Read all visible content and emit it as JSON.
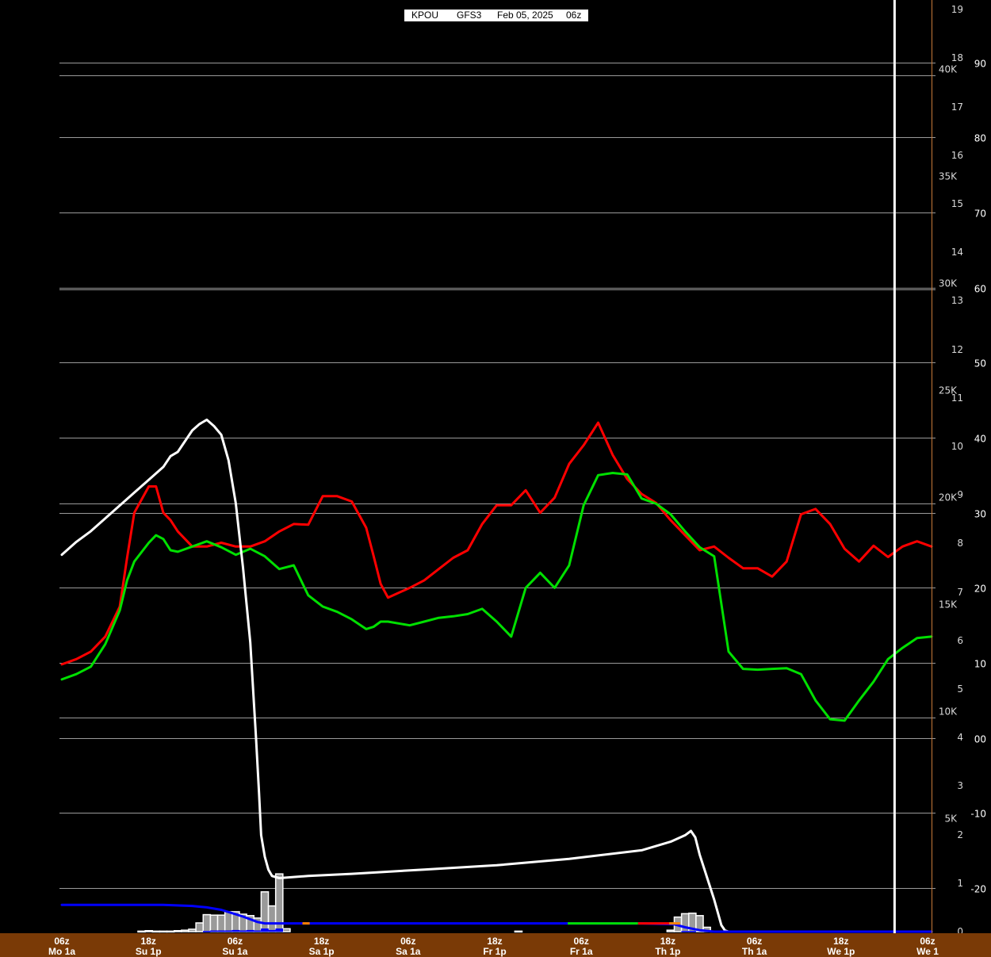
{
  "header": {
    "station": "KPOU",
    "model": "GFS3",
    "date": "Feb 05, 2025",
    "cycle": "06z"
  },
  "colors": {
    "background": "#000000",
    "grid": "#9a9a9a",
    "temperature": "#ff0000",
    "dewpoint": "#00e000",
    "freezing_level": "#ffffff",
    "snow_total": "#0000ff",
    "precip_bars": "#9a9a9a",
    "time_bar": "#7a3a06",
    "right_axis_line": "#c87a3a"
  },
  "chart_data": {
    "type": "line",
    "x_axis": {
      "ticks": [
        {
          "hour": "06z",
          "day": "Mo 1a"
        },
        {
          "hour": "18z",
          "day": "Su 1p"
        },
        {
          "hour": "06z",
          "day": "Su 1a"
        },
        {
          "hour": "18z",
          "day": "Sa 1p"
        },
        {
          "hour": "06z",
          "day": "Sa 1a"
        },
        {
          "hour": "18z",
          "day": "Fr 1p"
        },
        {
          "hour": "06z",
          "day": "Fr 1a"
        },
        {
          "hour": "18z",
          "day": "Th 1p"
        },
        {
          "hour": "06z",
          "day": "Th 1a"
        },
        {
          "hour": "18z",
          "day": "We 1p"
        },
        {
          "hour": "06z",
          "day": "We 1"
        }
      ],
      "range_hours": [
        0,
        120
      ],
      "current_time_hour": 114.9
    },
    "temperature_axis": {
      "ticks": [
        -20,
        -10,
        0,
        10,
        20,
        30,
        40,
        50,
        60,
        70,
        80,
        90
      ],
      "tick_labels": [
        "-20",
        "-10",
        "00",
        "10",
        "20",
        "30",
        "40",
        "50",
        "60",
        "70",
        "80",
        "90"
      ],
      "range": [
        -25.8,
        98.3
      ]
    },
    "height_axis": {
      "ticks": [
        5,
        10,
        15,
        20,
        25,
        30,
        35,
        40
      ],
      "tick_labels": [
        "5K",
        "10K",
        "15K",
        "20K",
        "25K",
        "30K",
        "35K",
        "40K"
      ],
      "unit": "thousand ft",
      "range": [
        0,
        43.5
      ]
    },
    "precip_axis": {
      "ticks": [
        0,
        1,
        2,
        3,
        4,
        5,
        6,
        7,
        8,
        9,
        10,
        11,
        12,
        13,
        14,
        15,
        16,
        17,
        18,
        19
      ],
      "tick_labels": [
        "0",
        "1",
        "2",
        "3",
        "4",
        "5",
        "6",
        "7",
        "8",
        "9",
        "10",
        "11",
        "12",
        "13",
        "14",
        "15",
        "16",
        "17",
        "18",
        "19"
      ],
      "range": [
        0,
        19.2
      ]
    },
    "grid": true,
    "series": [
      {
        "type": "line",
        "axis": "temperature",
        "color": "#ff0000",
        "x": [
          0,
          2,
          4,
          6,
          8,
          9,
          10,
          12,
          13,
          14,
          15,
          16,
          18,
          20,
          22,
          24,
          26,
          28,
          30,
          32,
          34,
          36,
          38,
          40,
          42,
          43,
          44,
          45,
          48,
          50,
          52,
          54,
          56,
          58,
          60,
          62,
          64,
          66,
          68,
          70,
          72,
          74,
          76,
          78,
          80,
          82,
          84,
          86,
          88,
          90,
          92,
          94,
          96,
          98,
          100,
          102,
          104,
          106,
          108,
          110,
          112,
          114,
          116,
          118,
          120
        ],
        "y": [
          9.8,
          10.5,
          11.5,
          13.5,
          17.5,
          24,
          30,
          33.5,
          33.5,
          30,
          29,
          27.5,
          25.5,
          25.5,
          26,
          25.5,
          25.5,
          26.2,
          27.5,
          28.5,
          28.4,
          32.2,
          32.2,
          31.5,
          28,
          24.3,
          20.5,
          18.7,
          20,
          21,
          22.5,
          24,
          25,
          28.5,
          31,
          31,
          33,
          30,
          32,
          36.5,
          39,
          42,
          37.7,
          34.5,
          32.5,
          31.3,
          29,
          27,
          25,
          25.5,
          24,
          22.6,
          22.6,
          21.5,
          23.5,
          29.8,
          30.5,
          28.5,
          25.2,
          23.5,
          25.6,
          24.1,
          25.5,
          26.2,
          25.5
        ]
      },
      {
        "type": "line",
        "axis": "temperature",
        "color": "#00e000",
        "x": [
          0,
          2,
          4,
          6,
          8,
          9,
          10,
          12,
          13,
          14,
          15,
          16,
          18,
          20,
          22,
          24,
          26,
          28,
          30,
          32,
          34,
          36,
          38,
          40,
          42,
          43,
          44,
          45,
          48,
          50,
          52,
          54,
          56,
          58,
          60,
          62,
          64,
          66,
          68,
          70,
          72,
          74,
          76,
          78,
          80,
          82,
          84,
          86,
          88,
          90,
          92,
          94,
          96,
          98,
          100,
          102,
          104,
          106,
          108,
          110,
          112,
          114,
          116,
          118,
          120
        ],
        "y": [
          7.8,
          8.5,
          9.5,
          12.5,
          17,
          21,
          23.5,
          26,
          27,
          26.5,
          25,
          24.8,
          25.5,
          26.2,
          25.4,
          24.4,
          25.2,
          24.2,
          22.5,
          23,
          19,
          17.5,
          16.8,
          15.8,
          14.5,
          14.8,
          15.5,
          15.5,
          15,
          15.5,
          16,
          16.2,
          16.5,
          17.2,
          15.5,
          13.5,
          20,
          22,
          20,
          23,
          31,
          35,
          35.3,
          35.1,
          31.9,
          31.2,
          29.8,
          27.5,
          25.4,
          24.2,
          11.5,
          9.2,
          9.1,
          9.2,
          9.3,
          8.5,
          5,
          2.5,
          2.3,
          5,
          7.5,
          10.5,
          12,
          13.3,
          13.5
        ]
      },
      {
        "type": "line",
        "axis": "height",
        "color": "#ffffff",
        "x": [
          0,
          2,
          4,
          6,
          8,
          10,
          12,
          14,
          15,
          16,
          17,
          18,
          19,
          20,
          21,
          22,
          23,
          24,
          25,
          26,
          26.8,
          27.2,
          27.5,
          28,
          28.5,
          29,
          30,
          34,
          40,
          50,
          60,
          70,
          80,
          84,
          86,
          86.8,
          87.4,
          88,
          90,
          91,
          91.5,
          92,
          93,
          94,
          100,
          110,
          120
        ],
        "y": [
          17.6,
          18.2,
          18.7,
          19.3,
          19.9,
          20.5,
          21.1,
          21.7,
          22.2,
          22.4,
          22.9,
          23.4,
          23.7,
          23.9,
          23.6,
          23.2,
          22,
          20,
          17,
          13.5,
          9,
          6.5,
          4.5,
          3.5,
          2.9,
          2.6,
          2.5,
          2.6,
          2.7,
          2.9,
          3.1,
          3.4,
          3.8,
          4.2,
          4.5,
          4.7,
          4.4,
          3.6,
          1.5,
          0.3,
          0.05,
          0,
          0,
          0,
          0,
          0,
          0
        ]
      },
      {
        "type": "line",
        "axis": "precip",
        "color": "#0000ff",
        "segments": [
          {
            "from_hour": 33.2,
            "to_hour": 34.2,
            "color": "#ff8000"
          },
          {
            "from_hour": 69.8,
            "to_hour": 79.5,
            "color": "#00e000"
          },
          {
            "from_hour": 79.5,
            "to_hour": 83.8,
            "color": "#ff0000"
          },
          {
            "from_hour": 83.8,
            "to_hour": 85.3,
            "color": "#ff8000"
          }
        ],
        "x": [
          0,
          14,
          18,
          20,
          22,
          23.5,
          25,
          27,
          28,
          29,
          29.7,
          30.5,
          40,
          60,
          80,
          84.5,
          86,
          88,
          90,
          91,
          92,
          120
        ],
        "y": [
          0.55,
          0.55,
          0.53,
          0.5,
          0.45,
          0.38,
          0.31,
          0.2,
          0.17,
          0.17,
          0.17,
          0.17,
          0.17,
          0.17,
          0.17,
          0.15,
          0.09,
          0.03,
          0,
          0,
          0,
          0
        ]
      },
      {
        "type": "bar",
        "axis": "precip",
        "color": "#9a9a9a",
        "bar_width_hours": 1,
        "x": [
          11,
          12,
          13,
          14,
          15,
          16,
          17,
          18,
          19,
          20,
          21,
          22,
          23,
          24,
          25,
          26,
          27,
          28,
          29,
          30,
          31,
          63,
          84,
          85,
          86,
          87,
          88,
          89,
          90,
          91
        ],
        "y": [
          0.01,
          0.02,
          0.01,
          0.01,
          0.01,
          0.02,
          0.03,
          0.05,
          0.18,
          0.35,
          0.34,
          0.34,
          0.41,
          0.41,
          0.36,
          0.33,
          0.28,
          0.82,
          0.53,
          1.19,
          0.06,
          0.01,
          0.03,
          0.3,
          0.37,
          0.38,
          0.33,
          0.09,
          0.01,
          0.01
        ]
      },
      {
        "type": "bar",
        "axis": "precip",
        "color": "#0000ff",
        "bar_width_hours": 1,
        "x": [
          20,
          21,
          22,
          23,
          24,
          25,
          26,
          27,
          28,
          29,
          30,
          86,
          87
        ],
        "y": [
          0.01,
          0.02,
          0.02,
          0.02,
          0.03,
          0.02,
          0.03,
          0.02,
          0.06,
          0.03,
          0.06,
          0.01,
          0.01
        ]
      }
    ]
  }
}
